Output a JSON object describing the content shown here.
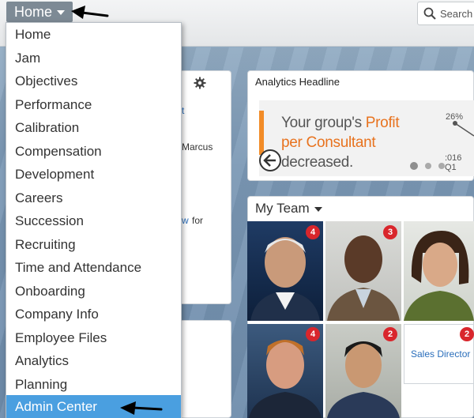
{
  "header": {
    "home_label": "Home",
    "search_placeholder": "Search f"
  },
  "menu": {
    "items": [
      {
        "label": "Home"
      },
      {
        "label": "Jam"
      },
      {
        "label": "Objectives"
      },
      {
        "label": "Performance"
      },
      {
        "label": "Calibration"
      },
      {
        "label": "Compensation"
      },
      {
        "label": "Development"
      },
      {
        "label": "Careers"
      },
      {
        "label": "Succession"
      },
      {
        "label": "Recruiting"
      },
      {
        "label": "Time and Attendance"
      },
      {
        "label": "Onboarding"
      },
      {
        "label": "Company Info"
      },
      {
        "label": "Employee Files"
      },
      {
        "label": "Analytics"
      },
      {
        "label": "Planning"
      },
      {
        "label": "Admin Center"
      }
    ],
    "selected": "Admin Center"
  },
  "left_card": {
    "fragment_link_top": "t",
    "fragment_name": "Marcus",
    "fragment_link_bottom": "w",
    "fragment_for": "for"
  },
  "analytics": {
    "title": "Analytics Headline",
    "banner_prefix": "Your group's ",
    "banner_highlight": "Profit per Consultant",
    "banner_suffix": " decreased.",
    "percent": "26%",
    "year": ":016 Q1"
  },
  "team": {
    "title": "My Team",
    "members": [
      {
        "badge": "4"
      },
      {
        "badge": "3"
      },
      {
        "badge": ""
      },
      {
        "badge": "4"
      },
      {
        "badge": "2"
      },
      {
        "badge": "2"
      }
    ],
    "role_label": "Sales Director"
  },
  "colors": {
    "menu_selected": "#4a9fe0",
    "badge": "#d9262c",
    "highlight": "#e8731f",
    "link": "#2a6ebb"
  }
}
